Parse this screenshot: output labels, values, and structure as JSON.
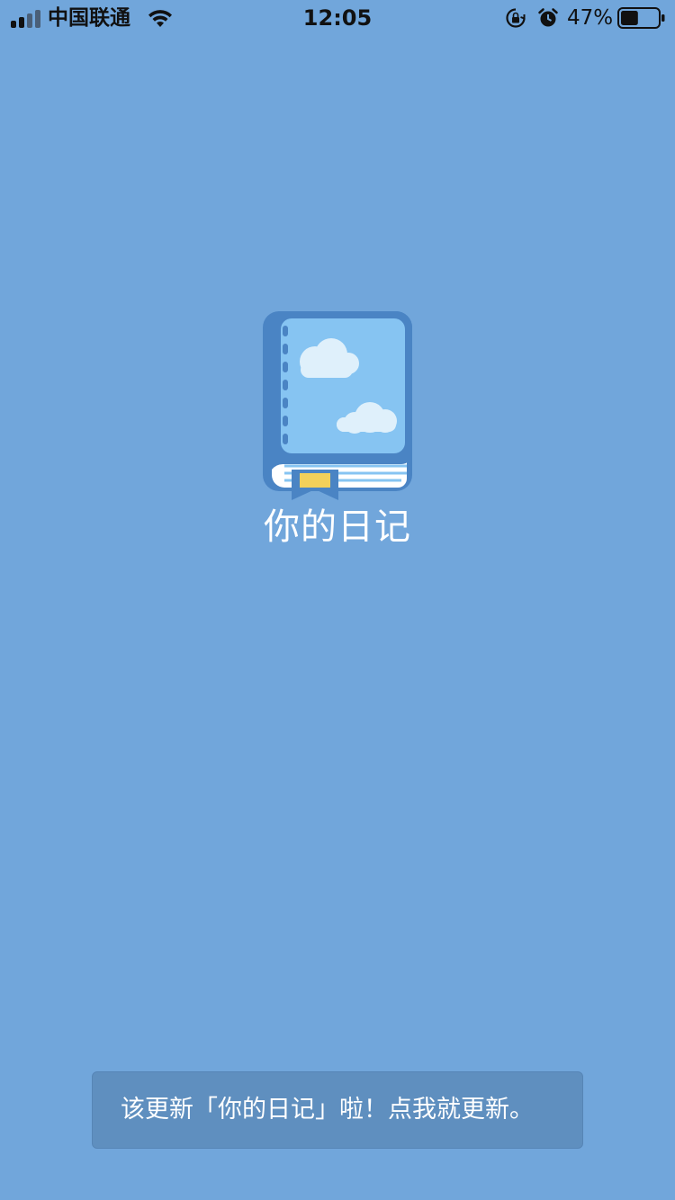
{
  "status_bar": {
    "carrier": "中国联通",
    "time": "12:05",
    "battery_percent": "47%",
    "battery_level": 0.47,
    "icons": [
      "signal-icon",
      "wifi-icon",
      "orientation-lock-icon",
      "alarm-icon",
      "battery-icon"
    ]
  },
  "splash": {
    "app_name": "你的日记",
    "logo_icon": "diary-book-icon"
  },
  "update_banner": {
    "text": "该更新「你的日记」啦！点我就更新。"
  },
  "colors": {
    "background": "#71a6db",
    "banner": "#5f8fbf",
    "book_cover": "#4a84c4",
    "book_page": "#86c4f2",
    "bookmark": "#f2d05a"
  }
}
